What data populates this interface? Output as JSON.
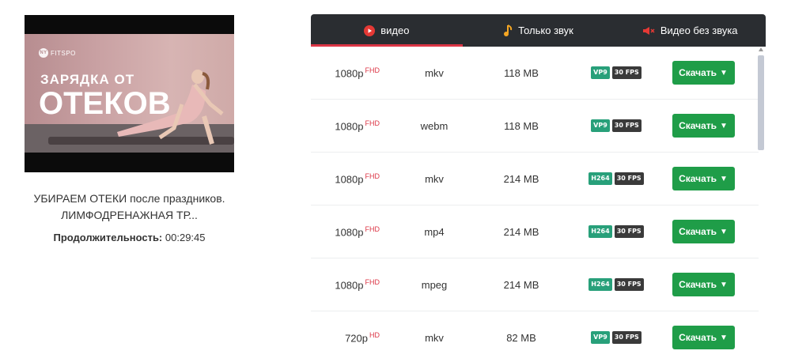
{
  "video": {
    "thumbnail_logo": "FITSPO",
    "thumbnail_line1": "ЗАРЯДКА ОТ",
    "thumbnail_line2": "ОТЕКОВ",
    "title": "УБИРАЕМ ОТЕКИ после праздников. ЛИМФОДРЕНАЖНАЯ ТР...",
    "duration_label": "Продолжительность:",
    "duration_value": "00:29:45"
  },
  "tabs": [
    {
      "label": "видео",
      "icon": "youtube-icon",
      "active": true
    },
    {
      "label": "Только звук",
      "icon": "music-note-icon",
      "active": false
    },
    {
      "label": "Видео без звука",
      "icon": "mute-speaker-icon",
      "active": false
    }
  ],
  "rows": [
    {
      "quality": "1080p",
      "tag": "FHD",
      "format": "mkv",
      "size": "118 MB",
      "codec": "VP9",
      "fps": "30 FPS",
      "button": "Скачать"
    },
    {
      "quality": "1080p",
      "tag": "FHD",
      "format": "webm",
      "size": "118 MB",
      "codec": "VP9",
      "fps": "30 FPS",
      "button": "Скачать"
    },
    {
      "quality": "1080p",
      "tag": "FHD",
      "format": "mkv",
      "size": "214 MB",
      "codec": "H264",
      "fps": "30 FPS",
      "button": "Скачать"
    },
    {
      "quality": "1080p",
      "tag": "FHD",
      "format": "mp4",
      "size": "214 MB",
      "codec": "H264",
      "fps": "30 FPS",
      "button": "Скачать"
    },
    {
      "quality": "1080p",
      "tag": "FHD",
      "format": "mpeg",
      "size": "214 MB",
      "codec": "H264",
      "fps": "30 FPS",
      "button": "Скачать"
    },
    {
      "quality": "720p",
      "tag": "HD",
      "format": "mkv",
      "size": "82 MB",
      "codec": "VP9",
      "fps": "30 FPS",
      "button": "Скачать"
    }
  ],
  "colors": {
    "tab_bar": "#2a2d31",
    "active_underline": "#dc3545",
    "download_button": "#1f9d48",
    "codec_badge": "#28a07a",
    "fps_badge": "#3a3a3a",
    "quality_tag": "#dc3545"
  }
}
